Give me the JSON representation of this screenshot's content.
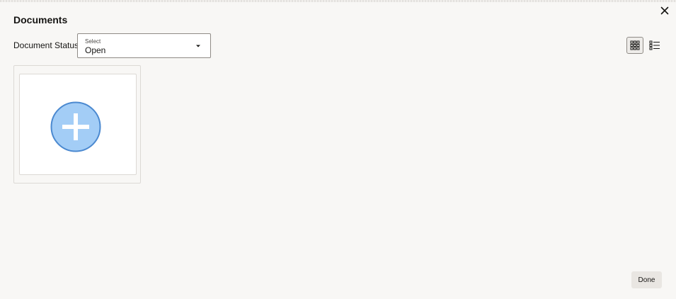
{
  "dialog": {
    "title": "Documents",
    "close_icon": "close-icon"
  },
  "filter": {
    "label": "Document Status:",
    "select_hint": "Select",
    "selected_value": "Open",
    "caret_icon": "caret-down-icon"
  },
  "view_toggle": {
    "grid_icon": "grid-view-icon",
    "list_icon": "list-view-icon",
    "active": "grid"
  },
  "add_card": {
    "icon": "add-circle-icon",
    "accent_fill": "#a3cdf6",
    "accent_stroke": "#4b89d0"
  },
  "footer": {
    "done_label": "Done"
  }
}
